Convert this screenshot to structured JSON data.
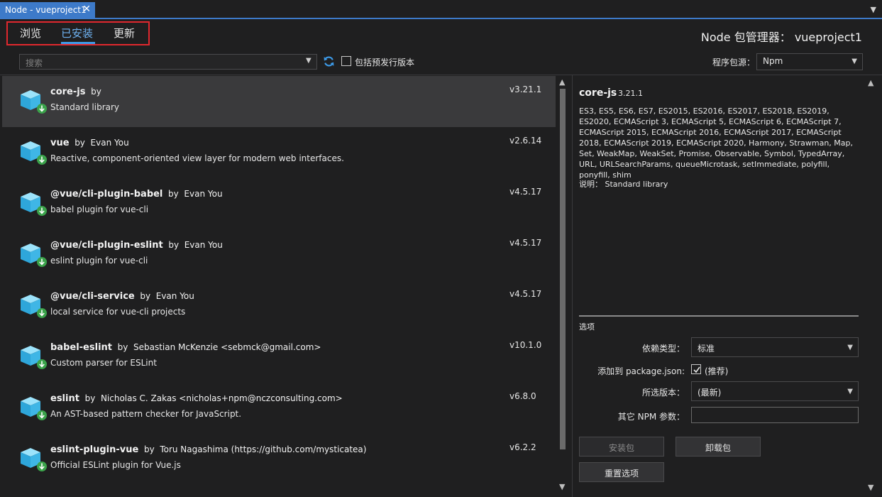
{
  "window": {
    "tab_title": "Node - vueproject1",
    "close_glyph": "✕"
  },
  "subtabs": {
    "browse": "浏览",
    "installed": "已安装",
    "updates": "更新",
    "active": "installed"
  },
  "manager_title": "Node 包管理器： vueproject1",
  "search": {
    "placeholder": "搜索",
    "include_prerelease_label": "包括预发行版本",
    "include_prerelease_checked": false
  },
  "source": {
    "label": "程序包源：",
    "value": "Npm"
  },
  "packages": [
    {
      "name": "core-js",
      "by": "by",
      "author": "",
      "description": "Standard library",
      "version": "v3.21.1",
      "selected": true
    },
    {
      "name": "vue",
      "by": "by",
      "author": "Evan You",
      "description": "Reactive, component-oriented view layer for modern web interfaces.",
      "version": "v2.6.14",
      "selected": false
    },
    {
      "name": "@vue/cli-plugin-babel",
      "by": "by",
      "author": "Evan You",
      "description": "babel plugin for vue-cli",
      "version": "v4.5.17",
      "selected": false
    },
    {
      "name": "@vue/cli-plugin-eslint",
      "by": "by",
      "author": "Evan You",
      "description": "eslint plugin for vue-cli",
      "version": "v4.5.17",
      "selected": false
    },
    {
      "name": "@vue/cli-service",
      "by": "by",
      "author": "Evan You",
      "description": "local service for vue-cli projects",
      "version": "v4.5.17",
      "selected": false
    },
    {
      "name": "babel-eslint",
      "by": "by",
      "author": "Sebastian McKenzie <sebmck@gmail.com>",
      "description": "Custom parser for ESLint",
      "version": "v10.1.0",
      "selected": false
    },
    {
      "name": "eslint",
      "by": "by",
      "author": "Nicholas C. Zakas <nicholas+npm@nczconsulting.com>",
      "description": "An AST-based pattern checker for JavaScript.",
      "version": "v6.8.0",
      "selected": false
    },
    {
      "name": "eslint-plugin-vue",
      "by": "by",
      "author": "Toru Nagashima (https://github.com/mysticatea)",
      "description": "Official ESLint plugin for Vue.js",
      "version": "v6.2.2",
      "selected": false
    }
  ],
  "details": {
    "name": "core-js",
    "version": "3.21.1",
    "keywords": "ES3, ES5, ES6, ES7, ES2015, ES2016, ES2017, ES2018, ES2019, ES2020, ECMAScript 3, ECMAScript 5, ECMAScript 6, ECMAScript 7, ECMAScript 2015, ECMAScript 2016, ECMAScript 2017, ECMAScript 2018, ECMAScript 2019, ECMAScript 2020, Harmony, Strawman, Map, Set, WeakMap, WeakSet, Promise, Observable, Symbol, TypedArray, URL, URLSearchParams, queueMicrotask, setImmediate, polyfill, ponyfill, shim",
    "description_line": "说明： Standard library"
  },
  "options": {
    "title": "选项",
    "dependency_type_label": "依赖类型：",
    "dependency_type_value": "标准",
    "add_to_package_label": "添加到 package.json:",
    "add_to_package_checked": true,
    "add_to_package_note": "(推荐)",
    "selected_version_label": "所选版本：",
    "selected_version_value": "(最新)",
    "other_npm_args_label": "其它 NPM 参数：",
    "other_npm_args_value": ""
  },
  "buttons": {
    "install": "安装包",
    "uninstall": "卸载包",
    "reset": "重置选项"
  },
  "colors": {
    "accent": "#3d7ac9",
    "active_tab_text": "#6fb3f2",
    "highlight_border": "#e0282e",
    "install_badge": "#3aa24a",
    "cube": "#3fb6e6"
  }
}
